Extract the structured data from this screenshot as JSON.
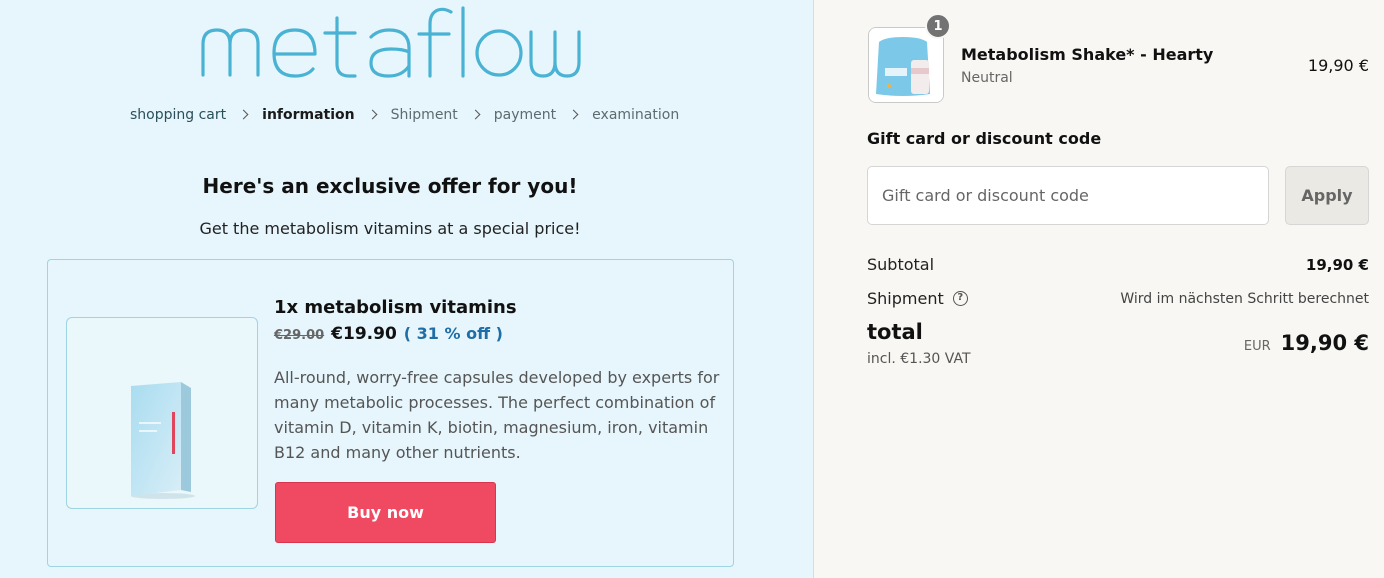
{
  "brand": {
    "logo_text": "metaflow"
  },
  "breadcrumb": [
    {
      "label": "shopping cart",
      "state": "link"
    },
    {
      "label": "information",
      "state": "active"
    },
    {
      "label": "Shipment",
      "state": "pending"
    },
    {
      "label": "payment",
      "state": "pending"
    },
    {
      "label": "examination",
      "state": "pending"
    }
  ],
  "offer": {
    "title": "Here's an exclusive offer for you!",
    "subtitle": "Get the metabolism vitamins at a special price!",
    "product_name": "1x metabolism vitamins",
    "old_price": "€29.00",
    "new_price": "€19.90",
    "discount": "( 31 % off )",
    "description": "All-round, worry-free capsules developed by experts for many metabolic processes. The perfect combination of vitamin D, vitamin K, biotin, magnesium, iron, vitamin B12 and many other nutrients.",
    "buy_label": "Buy now"
  },
  "cart": {
    "item": {
      "quantity": "1",
      "name": "Metabolism Shake* - Hearty",
      "variant": "Neutral",
      "price": "19,90 €"
    },
    "gift": {
      "label": "Gift card or discount code",
      "placeholder": "Gift card or discount code",
      "value": "",
      "apply_label": "Apply"
    },
    "subtotal_label": "Subtotal",
    "subtotal_value": "19,90 €",
    "shipment_label": "Shipment",
    "shipment_value": "Wird im nächsten Schritt berechnet",
    "total_label": "total",
    "vat_note": "incl. €1.30 VAT",
    "currency": "EUR",
    "total_value": "19,90 €"
  },
  "colors": {
    "left_bg": "#e6f6fc",
    "right_bg": "#f8f7f3",
    "accent_logo": "#4ab3d4",
    "buy_button": "#f04a63",
    "discount_text": "#1f6fa6"
  }
}
